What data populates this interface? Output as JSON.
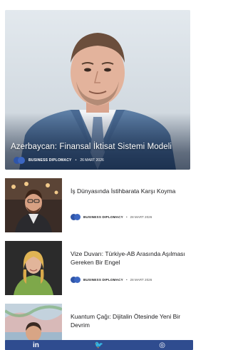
{
  "hero": {
    "title": "Azerbaycan: Finansal İktisat Sistemi Modeli",
    "category": "BUSINESS DIPLOMACY",
    "separator": "•",
    "date": "26 MART 2026"
  },
  "articles": [
    {
      "headline": "İş Dünyasında İstihbarata Karşı Koyma",
      "category": "BUSINESS DIPLOMACY",
      "separator": "•",
      "date": "28 MART 2026"
    },
    {
      "headline": "Vize Duvarı: Türkiye-AB Arasında Aşılması Gereken Bir Engel",
      "category": "BUSINESS DIPLOMACY",
      "separator": "•",
      "date": "28 MART 2026"
    },
    {
      "headline": "Kuantum Çağı: Dijitalin Ötesinde Yeni Bir Devrim",
      "category": "",
      "separator": "",
      "date": ""
    }
  ],
  "bottom_nav": {
    "linkedin": "in",
    "twitter": "🐦",
    "instagram": "◎"
  },
  "colors": {
    "accent": "#2f55a8",
    "bar": "#2f4c8f"
  },
  "icons": [
    "linkedin-icon",
    "twitter-icon",
    "instagram-icon",
    "category-toggle-icon"
  ]
}
